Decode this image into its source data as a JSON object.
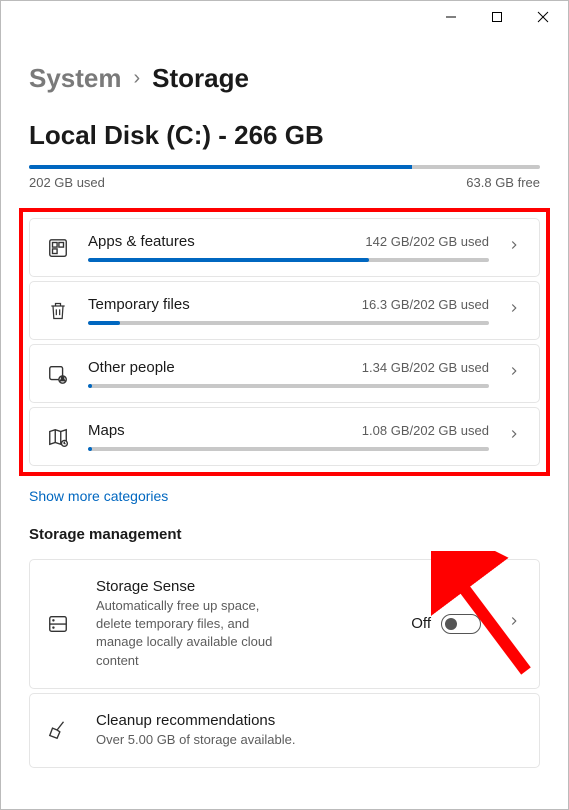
{
  "breadcrumb": {
    "parent": "System",
    "current": "Storage"
  },
  "disk": {
    "title": "Local Disk (C:) - 266 GB",
    "used_pct": 75,
    "used_label": "202 GB used",
    "free_label": "63.8 GB free"
  },
  "categories": [
    {
      "title": "Apps & features",
      "usage": "142 GB/202 GB used",
      "icon": "apps",
      "fill_pct": 70
    },
    {
      "title": "Temporary files",
      "usage": "16.3 GB/202 GB used",
      "icon": "trash",
      "fill_pct": 8
    },
    {
      "title": "Other people",
      "usage": "1.34 GB/202 GB used",
      "icon": "people",
      "fill_pct": 1
    },
    {
      "title": "Maps",
      "usage": "1.08 GB/202 GB used",
      "icon": "map",
      "fill_pct": 1
    }
  ],
  "show_more": "Show more categories",
  "mgmt_heading": "Storage management",
  "storage_sense": {
    "title": "Storage Sense",
    "desc": "Automatically free up space, delete temporary files, and manage locally available cloud content",
    "state_label": "Off"
  },
  "cleanup": {
    "title": "Cleanup recommendations",
    "desc": "Over 5.00 GB of storage available."
  }
}
